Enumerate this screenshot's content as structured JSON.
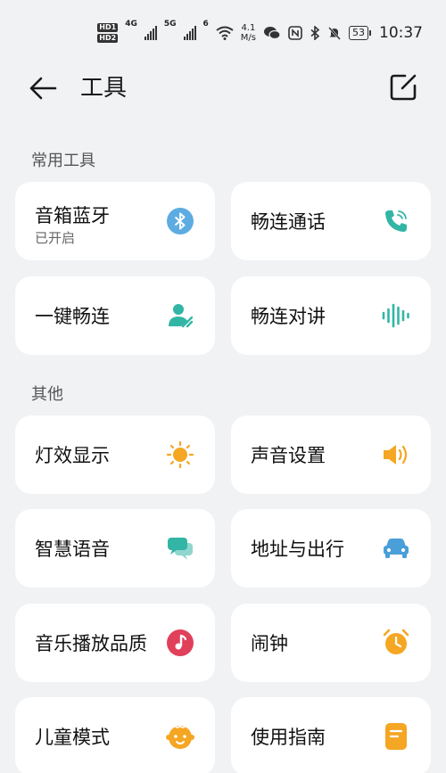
{
  "status_bar": {
    "hd1": "HD1",
    "hd2": "HD2",
    "net1": "4G",
    "net2": "5G",
    "wifi": "6",
    "speed_value": "4.1",
    "speed_unit": "M/s",
    "battery": "53",
    "time": "10:37"
  },
  "header": {
    "title": "工具"
  },
  "sections": {
    "common": "常用工具",
    "other": "其他"
  },
  "cards": {
    "speaker_bt": {
      "title": "音箱蓝牙",
      "subtitle": "已开启"
    },
    "call": {
      "title": "畅连通话"
    },
    "one_key": {
      "title": "一键畅连"
    },
    "intercom": {
      "title": "畅连对讲"
    },
    "light": {
      "title": "灯效显示"
    },
    "sound": {
      "title": "声音设置"
    },
    "voice": {
      "title": "智慧语音"
    },
    "address": {
      "title": "地址与出行"
    },
    "music": {
      "title": "音乐播放品质"
    },
    "alarm": {
      "title": "闹钟"
    },
    "kids": {
      "title": "儿童模式"
    },
    "guide": {
      "title": "使用指南"
    }
  },
  "colors": {
    "bluetooth": "#4aa3df",
    "teal": "#33b5a5",
    "orange": "#f5a623",
    "music_red": "#e0405a",
    "car_blue": "#4a9fd8"
  }
}
